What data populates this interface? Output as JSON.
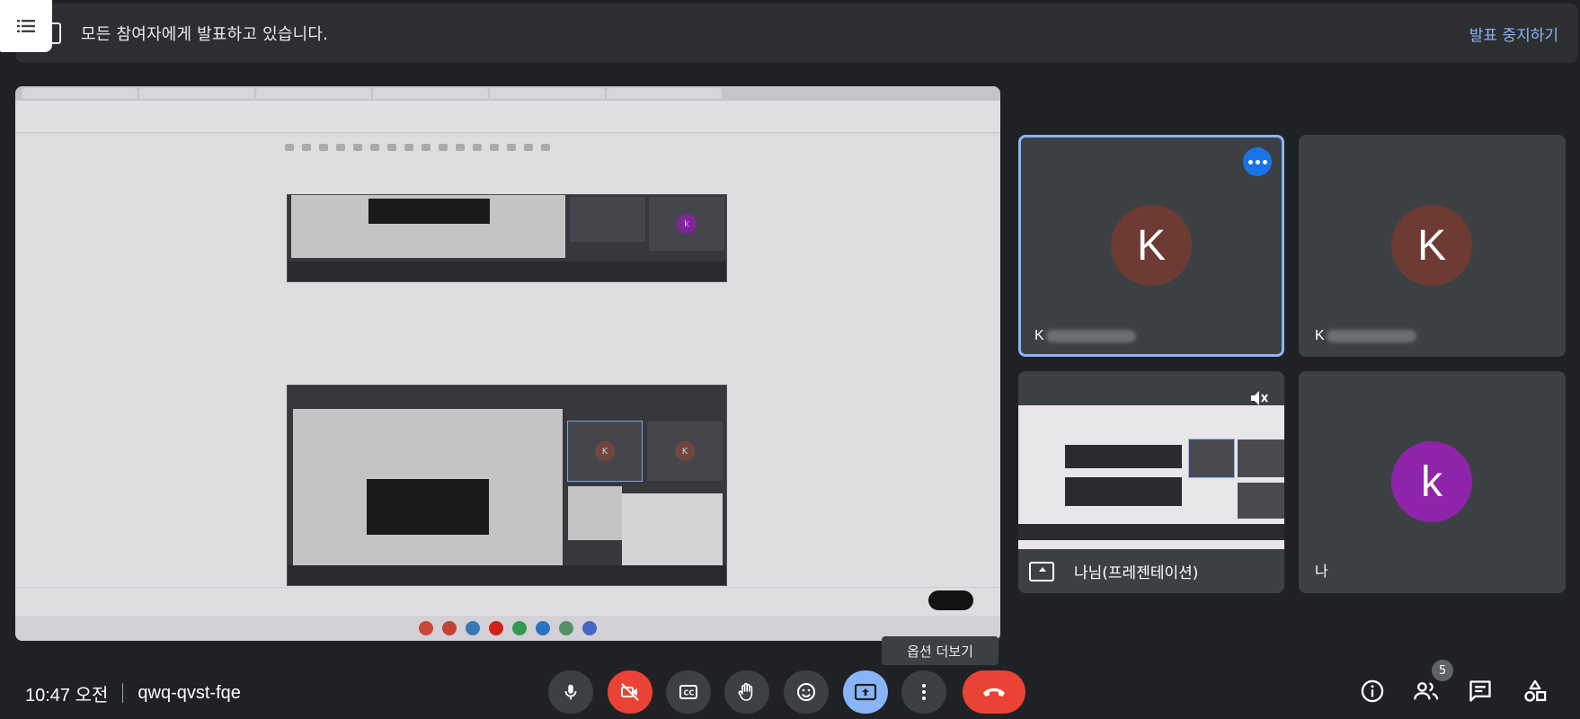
{
  "banner": {
    "text": "모든 참여자에게 발표하고 있습니다.",
    "stop_label": "발표 중지하기"
  },
  "participants": [
    {
      "initial": "K",
      "name_visible": "K",
      "color": "#6d3b34"
    },
    {
      "initial": "K",
      "name_visible": "K",
      "color": "#6d3b34"
    },
    {
      "label": "나님(프레젠테이션)"
    },
    {
      "initial": "k",
      "name": "나",
      "color": "#8e24aa"
    }
  ],
  "tooltip": "옵션 더보기",
  "meeting": {
    "time": "10:47 오전",
    "code": "qwq-qvst-fqe"
  },
  "people_count": "5",
  "colors": {
    "accent": "#8ab4f8",
    "danger": "#ea4335",
    "tile": "#3c4043",
    "background": "#202124"
  },
  "icons": [
    "list-icon",
    "present-icon",
    "more-vert-icon",
    "mic-icon",
    "camera-off-icon",
    "captions-icon",
    "raise-hand-icon",
    "emoji-icon",
    "present-screen-icon",
    "more-options-icon",
    "end-call-icon",
    "info-icon",
    "people-icon",
    "chat-icon",
    "activities-icon",
    "mic-off-icon"
  ]
}
